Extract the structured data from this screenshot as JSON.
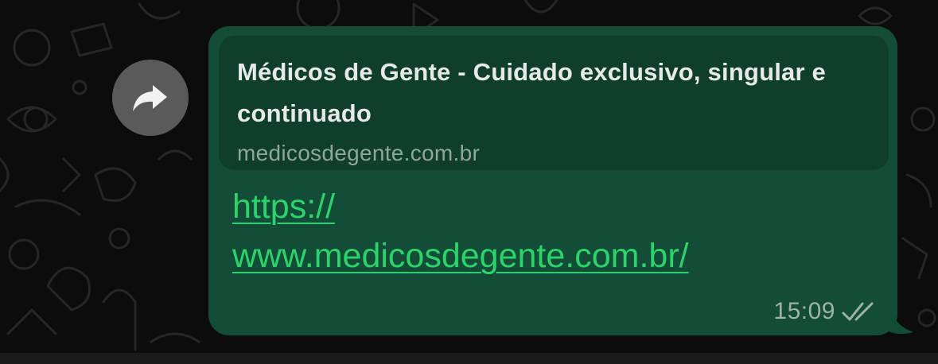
{
  "chat": {
    "background_color": "#0c0c0c"
  },
  "forward_button": {
    "icon": "forward-arrow-icon"
  },
  "message": {
    "bubble_color": "#134d37",
    "link_preview": {
      "title": "Médicos de Gente - Cuidado exclusivo, singular e continuado",
      "domain": "medicosdegente.com.br",
      "background_color": "#0f3f2c"
    },
    "link_lines": [
      "https://",
      "www.medicosdegente.com.br/"
    ],
    "link_color": "#2bd36a",
    "timestamp": "15:09",
    "status_icon": "double-check-icon"
  }
}
